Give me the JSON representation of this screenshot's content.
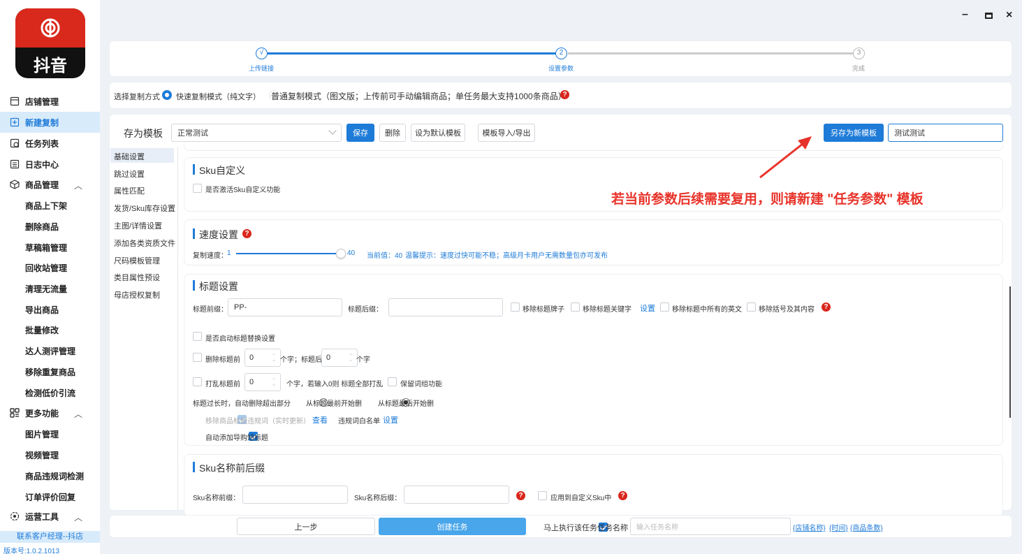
{
  "app": {
    "logo_text": "抖音",
    "version": "版本号:1.0.2.1013",
    "contact": "联系客户经理--抖店"
  },
  "window": {
    "minimize": "–",
    "maximize": "□",
    "close": "×"
  },
  "sidebar": {
    "top_items": [
      {
        "label": "店铺管理",
        "icon": "store-icon"
      },
      {
        "label": "新建复制",
        "icon": "add-copy-icon",
        "active": true
      },
      {
        "label": "任务列表",
        "icon": "task-list-icon"
      },
      {
        "label": "日志中心",
        "icon": "log-icon"
      }
    ],
    "goods": {
      "label": "商品管理",
      "icon": "box-icon",
      "chevron": "︿"
    },
    "goods_items": [
      "商品上下架",
      "删除商品",
      "草稿箱管理",
      "回收站管理",
      "清理无流量",
      "导出商品",
      "批量修改",
      "达人测评管理",
      "移除重复商品",
      "检测低价引流"
    ],
    "more": {
      "label": "更多功能",
      "icon": "grid-icon",
      "chevron": "︿"
    },
    "more_items": [
      "图片管理",
      "视频管理",
      "商品违规词检测",
      "订单评价回复"
    ],
    "ops": {
      "label": "运营工具",
      "icon": "ops-icon",
      "chevron": "︿"
    }
  },
  "steps": [
    {
      "num": "√",
      "label": "上传链接"
    },
    {
      "num": "2",
      "label": "设置参数"
    },
    {
      "num": "3",
      "label": "完成"
    }
  ],
  "copy_mode": {
    "label": "选择复制方式",
    "fast": "快速复制模式（纯文字）",
    "normal": "普通复制模式（图文版；上传前可手动编辑商品；单任务最大支持1000条商品）"
  },
  "template_bar": {
    "label": "存为模板",
    "select_value": "正常测试",
    "save": "保存",
    "delete": "删除",
    "set_default": "设为默认模板",
    "import_export": "模板导入/导出",
    "save_new": "另存为新模板",
    "new_name": "测试测试"
  },
  "tabs": [
    "基础设置",
    "跳过设置",
    "属性匹配",
    "发货/Sku库存设置",
    "主图/详情设置",
    "添加各类资质文件",
    "尺码模板管理",
    "类目属性预设",
    "母店授权复制"
  ],
  "annotation": "若当前参数后续需要复用，则请新建 \"任务参数\" 模板",
  "sku_custom": {
    "title": "Sku自定义",
    "activate": "是否激活Sku自定义功能"
  },
  "speed": {
    "title": "速度设置",
    "label": "复制速度：",
    "min": "1",
    "max": "40",
    "value": 40,
    "max_value": 40,
    "current": "当前值：40",
    "tip": "温馨提示：速度过快可能不稳；高级月卡用户无需数量包亦可发布"
  },
  "title_settings": {
    "title": "标题设置",
    "prefix_label": "标题前缀：",
    "prefix_value": "PP-",
    "suffix_label": "标题后缀：",
    "suffix_value": "",
    "remove_brand": "移除标题牌子",
    "remove_keywords": "移除标题关键字",
    "settings_link": "设置",
    "remove_english": "移除标题中所有的英文",
    "remove_brackets": "移除括号及其内容",
    "enable_replace": "是否启动标题替换设置",
    "delete_before": "删除标题前",
    "delete_before_val": "0",
    "chars_title_after": "个字；标题后",
    "delete_after_val": "0",
    "chars": "个字",
    "shuffle_before": "打乱标题前",
    "shuffle_val": "0",
    "shuffle_note": "个字，若输入0则 标题全部打乱",
    "keep_phrase": "保留词组功能",
    "too_long": "标题过长时，自动删除超出部分",
    "from_front": "从标题最前开始删",
    "from_back": "从标题最后开始删",
    "remove_violation": "移除商品标题违规词（实时更新）",
    "view": "查看",
    "whitelist": "违规词白名单",
    "whitelist_set": "设置",
    "auto_add_short": "自动添加导购短标题"
  },
  "sku_name": {
    "title": "Sku名称前后缀",
    "prefix_label": "Sku名称前缀：",
    "prefix_value": "",
    "suffix_label": "Sku名称后缀：",
    "suffix_value": "",
    "apply_custom": "应用到自定义Sku中"
  },
  "footer": {
    "prev": "上一步",
    "create": "创建任务",
    "run_now": "马上执行该任务",
    "task_name_label": "任务名称",
    "task_name_placeholder": "输入任务名称",
    "links": [
      "{店铺名称}",
      "{时间}",
      "{商品条数}"
    ]
  }
}
